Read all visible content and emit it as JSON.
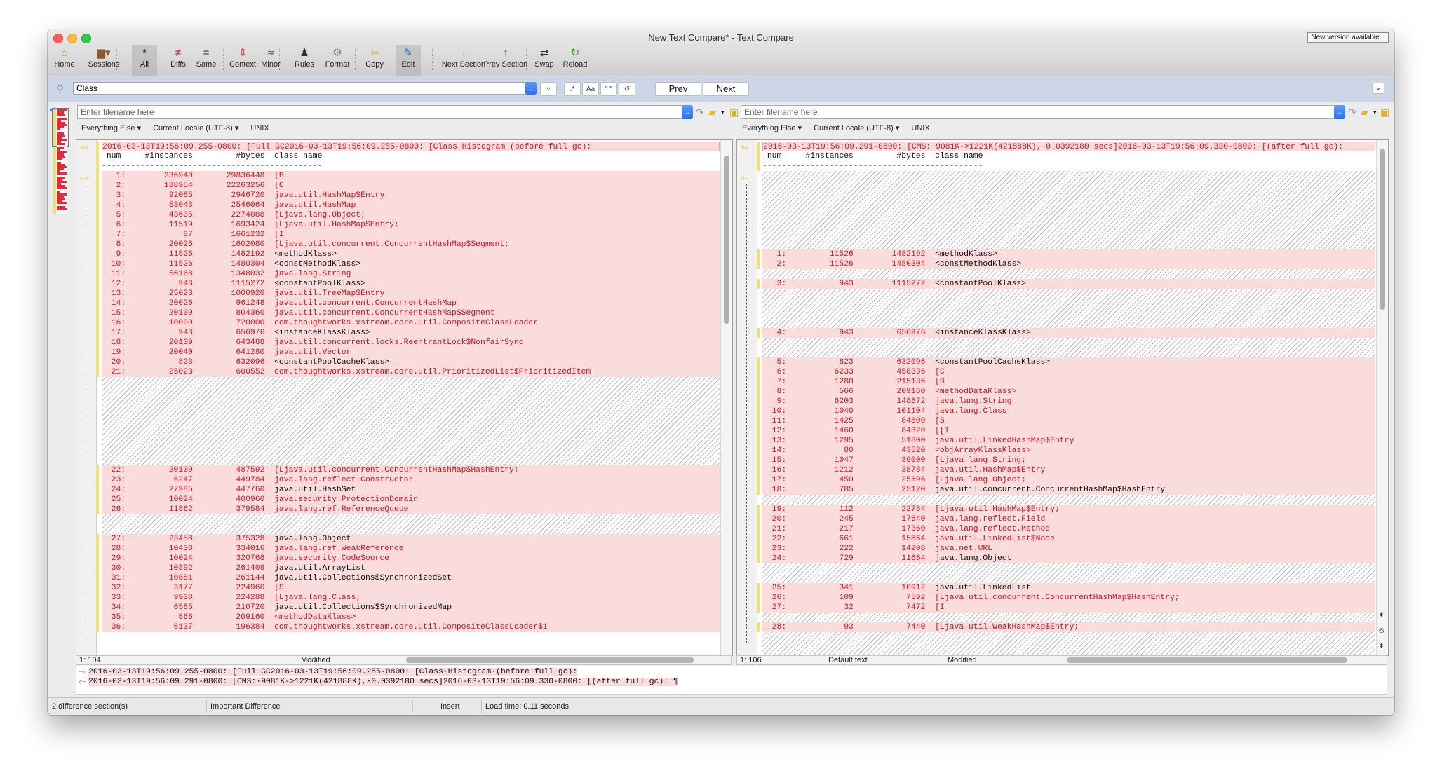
{
  "window": {
    "title": "New Text Compare* - Text Compare",
    "new_version_label": "New version available..."
  },
  "toolbar": {
    "items": [
      {
        "label": "Home",
        "icon": "home-icon",
        "glyph": "⌂"
      },
      {
        "label": "Sessions",
        "icon": "briefcase-icon",
        "glyph": "▆▾"
      },
      {
        "label": "All",
        "icon": "asterisk-icon",
        "glyph": "*"
      },
      {
        "label": "Diffs",
        "icon": "not-equal-icon",
        "glyph": "≠"
      },
      {
        "label": "Same",
        "icon": "equals-icon",
        "glyph": "="
      },
      {
        "label": "Context",
        "icon": "context-icon",
        "glyph": "⇕"
      },
      {
        "label": "Minor",
        "icon": "approx-icon",
        "glyph": "≈"
      },
      {
        "label": "Rules",
        "icon": "referee-icon",
        "glyph": "♟"
      },
      {
        "label": "Format",
        "icon": "format-icon",
        "glyph": "⚙"
      },
      {
        "label": "Copy",
        "icon": "copy-left-icon",
        "glyph": "⇦"
      },
      {
        "label": "Edit",
        "icon": "edit-icon",
        "glyph": "✎"
      },
      {
        "label": "Next Section",
        "icon": "arrow-down-icon",
        "glyph": "↓"
      },
      {
        "label": "Prev Section",
        "icon": "arrow-up-icon",
        "glyph": "↑"
      },
      {
        "label": "Swap",
        "icon": "swap-icon",
        "glyph": "⇄"
      },
      {
        "label": "Reload",
        "icon": "reload-icon",
        "glyph": "↻"
      }
    ]
  },
  "search": {
    "value": "Class",
    "regex_label": ".*",
    "case_label": "Aa",
    "whole_word_label": "\" \"",
    "reset_glyph": "↺",
    "prev_label": "Prev",
    "next_label": "Next"
  },
  "left": {
    "filename_placeholder": "Enter filename here",
    "format": "Everything Else ▾",
    "encoding": "Current Locale (UTF-8) ▾",
    "line_endings": "UNIX",
    "status_position": "1: 104",
    "status_state": "Modified",
    "first_line": "2016-03-13T19:56:09.255-0800: [Full GC2016-03-13T19:56:09.255-0800: [Class Histogram (before full gc):",
    "header_line": " num     #instances         #bytes  class name",
    "dash_line": "----------------------------------------------",
    "rows": [
      {
        "num": "1:",
        "instances": "236940",
        "bytes": "29836448",
        "class": "[B"
      },
      {
        "num": "2:",
        "instances": "188954",
        "bytes": "22263256",
        "class": "[C"
      },
      {
        "num": "3:",
        "instances": "92085",
        "bytes": "2946720",
        "class": "java.util.HashMap$Entry"
      },
      {
        "num": "4:",
        "instances": "53043",
        "bytes": "2546064",
        "class": "java.util.HashMap"
      },
      {
        "num": "5:",
        "instances": "43605",
        "bytes": "2274088",
        "class": "[Ljava.lang.Object;"
      },
      {
        "num": "6:",
        "instances": "11519",
        "bytes": "1693424",
        "class": "[Ljava.util.HashMap$Entry;"
      },
      {
        "num": "7:",
        "instances": "87",
        "bytes": "1661232",
        "class": "[I"
      },
      {
        "num": "8:",
        "instances": "20026",
        "bytes": "1602080",
        "class": "[Ljava.util.concurrent.ConcurrentHashMap$Segment;"
      },
      {
        "num": "9:",
        "instances": "11526",
        "bytes": "1482192",
        "class": "<methodKlass>",
        "plain": true
      },
      {
        "num": "10:",
        "instances": "11526",
        "bytes": "1480304",
        "class": "<constMethodKlass>",
        "plain": true
      },
      {
        "num": "11:",
        "instances": "56168",
        "bytes": "1348032",
        "class": "java.lang.String"
      },
      {
        "num": "12:",
        "instances": "943",
        "bytes": "1115272",
        "class": "<constantPoolKlass>",
        "plain": true
      },
      {
        "num": "13:",
        "instances": "25023",
        "bytes": "1000920",
        "class": "java.util.TreeMap$Entry"
      },
      {
        "num": "14:",
        "instances": "20026",
        "bytes": "961248",
        "class": "java.util.concurrent.ConcurrentHashMap"
      },
      {
        "num": "15:",
        "instances": "20109",
        "bytes": "804360",
        "class": "java.util.concurrent.ConcurrentHashMap$Segment"
      },
      {
        "num": "16:",
        "instances": "10000",
        "bytes": "720000",
        "class": "com.thoughtworks.xstream.core.util.CompositeClassLoader"
      },
      {
        "num": "17:",
        "instances": "943",
        "bytes": "656976",
        "class": "<instanceKlassKlass>",
        "plain": true
      },
      {
        "num": "18:",
        "instances": "20109",
        "bytes": "643488",
        "class": "java.util.concurrent.locks.ReentrantLock$NonfairSync"
      },
      {
        "num": "19:",
        "instances": "20040",
        "bytes": "641280",
        "class": "java.util.Vector"
      },
      {
        "num": "20:",
        "instances": "823",
        "bytes": "632096",
        "class": "<constantPoolCacheKlass>",
        "plain": true
      },
      {
        "num": "21:",
        "instances": "25023",
        "bytes": "600552",
        "class": "com.thoughtworks.xstream.core.util.PrioritizedList$PrioritizedItem"
      },
      {
        "num": "22:",
        "instances": "20109",
        "bytes": "487592",
        "class": "[Ljava.util.concurrent.ConcurrentHashMap$HashEntry;"
      },
      {
        "num": "23:",
        "instances": "6247",
        "bytes": "449784",
        "class": "java.lang.reflect.Constructor"
      },
      {
        "num": "24:",
        "instances": "27985",
        "bytes": "447760",
        "class": "java.util.HashSet",
        "plain": true
      },
      {
        "num": "25:",
        "instances": "10024",
        "bytes": "400960",
        "class": "java.security.ProtectionDomain"
      },
      {
        "num": "26:",
        "instances": "11862",
        "bytes": "379584",
        "class": "java.lang.ref.ReferenceQueue"
      },
      {
        "num": "27:",
        "instances": "23458",
        "bytes": "375328",
        "class": "java.lang.Object",
        "plain": true
      },
      {
        "num": "28:",
        "instances": "10438",
        "bytes": "334016",
        "class": "java.lang.ref.WeakReference"
      },
      {
        "num": "29:",
        "instances": "10024",
        "bytes": "320768",
        "class": "java.security.CodeSource"
      },
      {
        "num": "30:",
        "instances": "10892",
        "bytes": "261408",
        "class": "java.util.ArrayList",
        "plain": true
      },
      {
        "num": "31:",
        "instances": "10881",
        "bytes": "261144",
        "class": "java.util.Collections$SynchronizedSet",
        "plain": true
      },
      {
        "num": "32:",
        "instances": "3177",
        "bytes": "224960",
        "class": "[S"
      },
      {
        "num": "33:",
        "instances": "9938",
        "bytes": "224288",
        "class": "[Ljava.lang.Class;"
      },
      {
        "num": "34:",
        "instances": "6585",
        "bytes": "210720",
        "class": "java.util.Collections$SynchronizedMap",
        "plain": true
      },
      {
        "num": "35:",
        "instances": "566",
        "bytes": "209160",
        "class": "<methodDataKlass>"
      },
      {
        "num": "36:",
        "instances": "6137",
        "bytes": "196384",
        "class": "com.thoughtworks.xstream.core.util.CompositeClassLoader$1"
      }
    ]
  },
  "right": {
    "filename_placeholder": "Enter filename here",
    "format": "Everything Else ▾",
    "encoding": "Current Locale (UTF-8) ▾",
    "line_endings": "UNIX",
    "status_position": "1: 106",
    "status_format": "Default text",
    "status_state": "Modified",
    "first_line": "2016-03-13T19:56:09.291-0800: [CMS: 9081K->1221K(421888K), 0.0392180 secs]2016-03-13T19:56:09.330-0800: [(after full gc):",
    "header_line": " num     #instances         #bytes  class name",
    "dash_line": "----------------------------------------------",
    "rows": [
      {
        "num": "1:",
        "instances": "11526",
        "bytes": "1482192",
        "class": "<methodKlass>",
        "plain": true
      },
      {
        "num": "2:",
        "instances": "11526",
        "bytes": "1480304",
        "class": "<constMethodKlass>",
        "plain": true
      },
      {
        "num": "3:",
        "instances": "943",
        "bytes": "1115272",
        "class": "<constantPoolKlass>",
        "plain": true
      },
      {
        "num": "4:",
        "instances": "943",
        "bytes": "656976",
        "class": "<instanceKlassKlass>",
        "plain": true
      },
      {
        "num": "5:",
        "instances": "823",
        "bytes": "632096",
        "class": "<constantPoolCacheKlass>",
        "plain": true
      },
      {
        "num": "6:",
        "instances": "6233",
        "bytes": "458336",
        "class": "[C"
      },
      {
        "num": "7:",
        "instances": "1280",
        "bytes": "215136",
        "class": "[B"
      },
      {
        "num": "8:",
        "instances": "566",
        "bytes": "209160",
        "class": "<methodDataKlass>"
      },
      {
        "num": "9:",
        "instances": "6203",
        "bytes": "148872",
        "class": "java.lang.String"
      },
      {
        "num": "10:",
        "instances": "1040",
        "bytes": "101104",
        "class": "java.lang.Class"
      },
      {
        "num": "11:",
        "instances": "1425",
        "bytes": "84800",
        "class": "[S"
      },
      {
        "num": "12:",
        "instances": "1460",
        "bytes": "84320",
        "class": "[[I"
      },
      {
        "num": "13:",
        "instances": "1295",
        "bytes": "51800",
        "class": "java.util.LinkedHashMap$Entry"
      },
      {
        "num": "14:",
        "instances": "80",
        "bytes": "43520",
        "class": "<objArrayKlassKlass>"
      },
      {
        "num": "15:",
        "instances": "1047",
        "bytes": "39000",
        "class": "[Ljava.lang.String;"
      },
      {
        "num": "16:",
        "instances": "1212",
        "bytes": "38784",
        "class": "java.util.HashMap$Entry"
      },
      {
        "num": "17:",
        "instances": "450",
        "bytes": "25696",
        "class": "[Ljava.lang.Object;"
      },
      {
        "num": "18:",
        "instances": "785",
        "bytes": "25120",
        "class": "java.util.concurrent.ConcurrentHashMap$HashEntry",
        "plain": true
      },
      {
        "num": "19:",
        "instances": "112",
        "bytes": "22784",
        "class": "[Ljava.util.HashMap$Entry;"
      },
      {
        "num": "20:",
        "instances": "245",
        "bytes": "17640",
        "class": "java.lang.reflect.Field"
      },
      {
        "num": "21:",
        "instances": "217",
        "bytes": "17360",
        "class": "java.lang.reflect.Method"
      },
      {
        "num": "22:",
        "instances": "661",
        "bytes": "15864",
        "class": "java.util.LinkedList$Node"
      },
      {
        "num": "23:",
        "instances": "222",
        "bytes": "14208",
        "class": "java.net.URL"
      },
      {
        "num": "24:",
        "instances": "729",
        "bytes": "11664",
        "class": "java.lang.Object",
        "plain": true
      },
      {
        "num": "25:",
        "instances": "341",
        "bytes": "10912",
        "class": "java.util.LinkedList",
        "plain": true
      },
      {
        "num": "26:",
        "instances": "109",
        "bytes": "7592",
        "class": "[Ljava.util.concurrent.ConcurrentHashMap$HashEntry;"
      },
      {
        "num": "27:",
        "instances": "32",
        "bytes": "7472",
        "class": "[I"
      },
      {
        "num": "28:",
        "instances": "93",
        "bytes": "7440",
        "class": "[Ljava.util.WeakHashMap$Entry;"
      }
    ]
  },
  "compare_strip": {
    "left_line": "2016-03-13T19:56:09.255-0800: [Full GC2016-03-13T19:56:09.255-0800: [Class·Histogram·(before full gc):",
    "right_line": "2016-03-13T19:56:09.291-0800: [CMS:·9081K->1221K(421888K),·0.0392180 secs]2016-03-13T19:56:09.330-0800: [(after full gc): ¶"
  },
  "statusbar": {
    "sections": "2 difference section(s)",
    "importance": "Important Difference",
    "mode": "Insert",
    "load_time": "Load time: 0.11 seconds"
  },
  "colors": {
    "diff_bg": "#fbdcdd",
    "diff_text": "#d2141d",
    "change_marker": "#f5e16a",
    "search_bar": "#cdd6e6"
  }
}
